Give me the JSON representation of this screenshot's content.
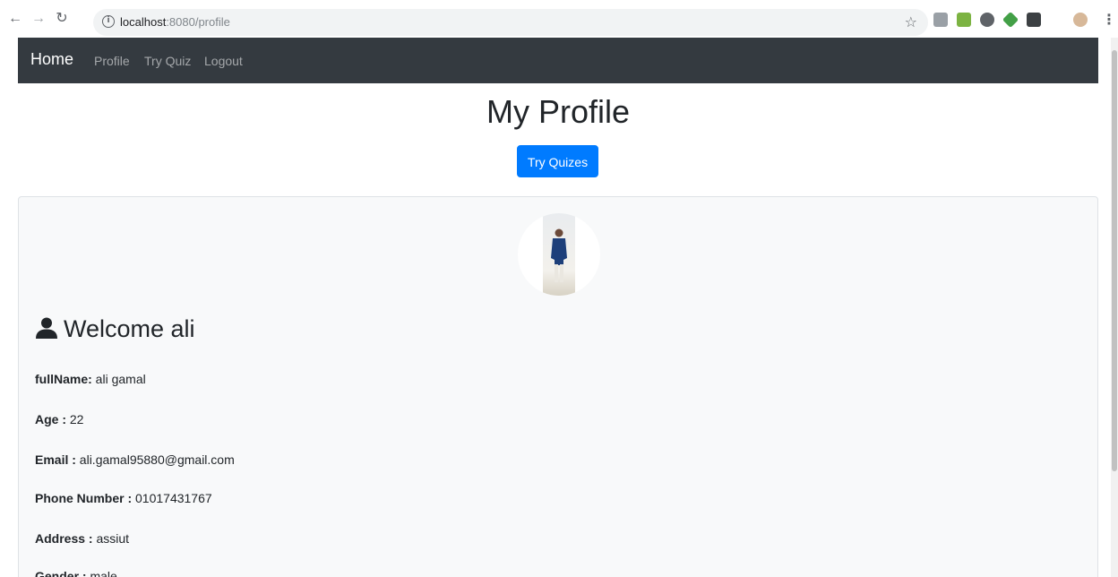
{
  "browser": {
    "url_host": "localhost",
    "url_rest": ":8080/profile"
  },
  "navbar": {
    "brand": "Home",
    "links": [
      "Profile",
      "Try Quiz",
      "Logout"
    ]
  },
  "page": {
    "title": "My Profile",
    "cta_label": "Try Quizes"
  },
  "profile": {
    "welcome": "Welcome ali",
    "fields": [
      {
        "label": "fullName:",
        "value": " ali gamal"
      },
      {
        "label": "Age :",
        "value": " 22"
      },
      {
        "label": "Email :",
        "value": " ali.gamal95880@gmail.com"
      },
      {
        "label": "Phone Number :",
        "value": " 01017431767"
      },
      {
        "label": "Address :",
        "value": " assiut"
      },
      {
        "label": "Gender :",
        "value": " male"
      }
    ]
  },
  "colors": {
    "navbar_bg": "#343a40",
    "primary": "#007bff",
    "card_bg": "#f8f9fa"
  }
}
